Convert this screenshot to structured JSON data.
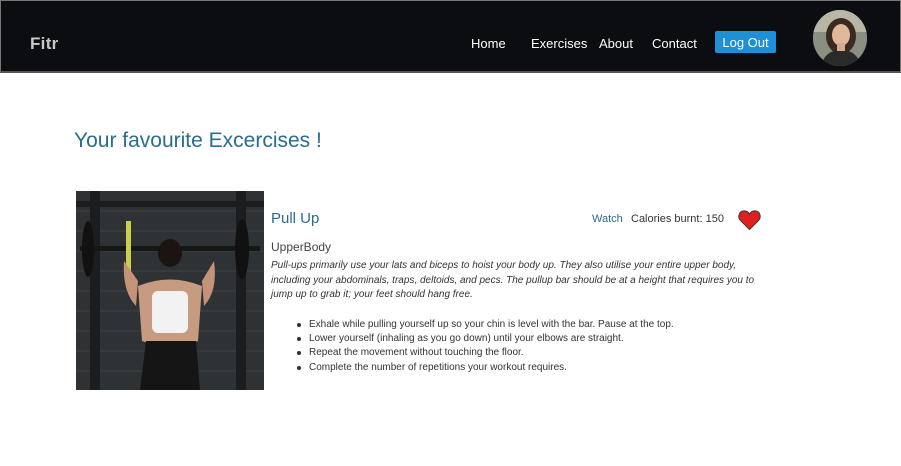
{
  "navbar": {
    "brand": "Fitr",
    "links": [
      "Home",
      "Exercises",
      "About",
      "Contact"
    ],
    "logout_label": "Log Out"
  },
  "page": {
    "title": "Your favourite Excercises !"
  },
  "exercise": {
    "name": "Pull Up",
    "watch_label": "Watch",
    "calories_text": "Calories burnt: 150",
    "category": "UpperBody",
    "description": "Pull-ups primarily use your lats and biceps to hoist your body up. They also utilise your entire upper body, including your abdominals, traps, deltoids, and pecs. The pullup bar should be at a height that requires you to jump up to grab it; your feet should hang free.",
    "steps": [
      "Exhale while pulling yourself up so your chin is level with the bar. Pause at the top.",
      "Lower yourself (inhaling as you go down) until your elbows are straight.",
      "Repeat the movement without touching the floor.",
      "Complete the number of repetitions your workout requires."
    ],
    "favourite": true
  },
  "colors": {
    "navbar_bg": "#0b0d10",
    "accent": "#2b6c8f",
    "logout_bg": "#1f8fd6",
    "heart": "#e02020"
  }
}
